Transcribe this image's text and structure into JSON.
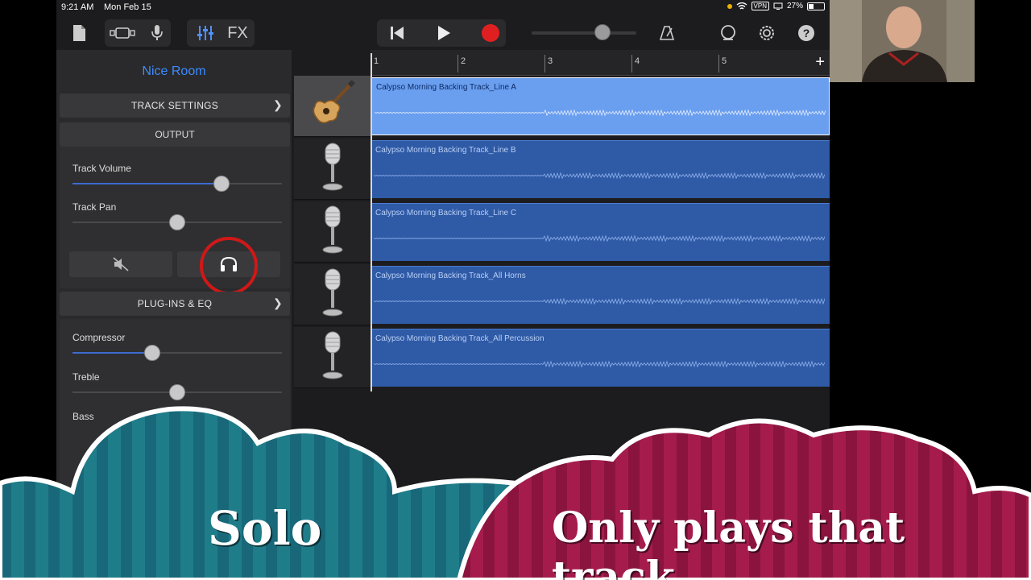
{
  "status_bar": {
    "time": "9:21 AM",
    "date": "Mon Feb 15",
    "vpn": "VPN",
    "battery": "27%"
  },
  "toolbar": {
    "fx_label": "FX",
    "icons": [
      "document-icon",
      "track-view-icon",
      "microphone-icon",
      "mixer-icon",
      "rewind-icon",
      "play-icon",
      "record-icon",
      "metronome-icon",
      "loop-icon",
      "settings-icon",
      "help-icon"
    ]
  },
  "inspector": {
    "patch_name": "Nice Room",
    "track_settings_label": "TRACK SETTINGS",
    "output_label": "OUTPUT",
    "track_volume_label": "Track Volume",
    "track_volume_value": 0.71,
    "track_pan_label": "Track Pan",
    "track_pan_value": 0.5,
    "plugins_eq_label": "PLUG-INS & EQ",
    "compressor_label": "Compressor",
    "compressor_value": 0.38,
    "treble_label": "Treble",
    "treble_value": 0.5,
    "bass_label": "Bass"
  },
  "ruler": {
    "bars": [
      "1",
      "2",
      "3",
      "4",
      "5"
    ]
  },
  "tracks": [
    {
      "name": "Calypso Morning Backing Track_Line A",
      "icon": "acoustic-guitar-icon",
      "selected": true
    },
    {
      "name": "Calypso Morning Backing Track_Line B",
      "icon": "microphone-icon",
      "selected": false
    },
    {
      "name": "Calypso Morning Backing Track_Line C",
      "icon": "microphone-icon",
      "selected": false
    },
    {
      "name": "Calypso Morning Backing Track_All Horns",
      "icon": "microphone-icon",
      "selected": false
    },
    {
      "name": "Calypso Morning Backing Track_All Percussion",
      "icon": "microphone-icon",
      "selected": false
    }
  ],
  "captions": {
    "left": "Solo",
    "right": "Only plays that track"
  },
  "colors": {
    "accent": "#3d8bff",
    "region": "#2f5aa6",
    "region_selected": "#6a9eef",
    "record": "#e02020",
    "highlight_circle": "#d01818",
    "cloud_left": "#1e7f8c",
    "cloud_right": "#a01c4a"
  }
}
